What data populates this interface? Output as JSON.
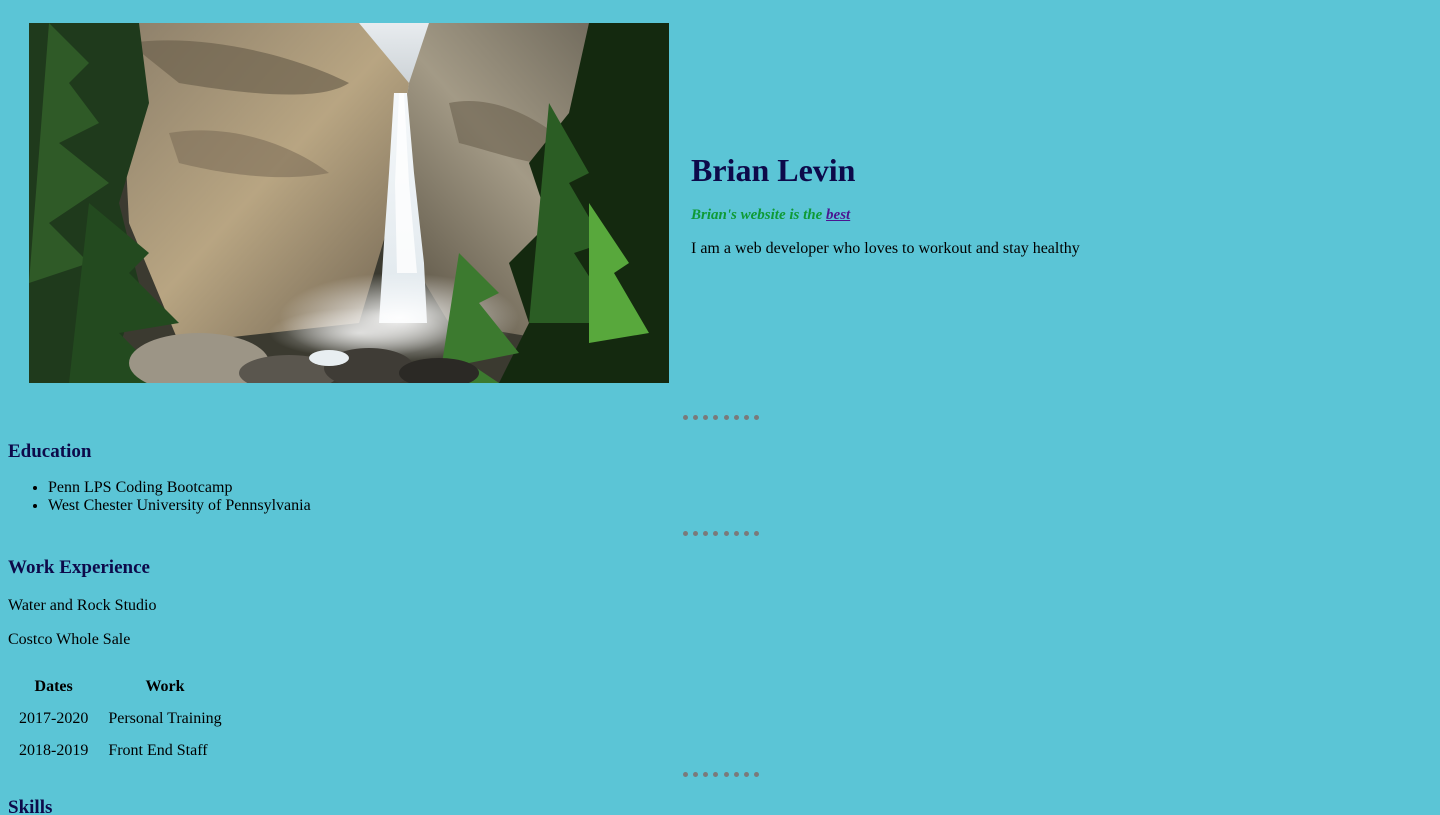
{
  "hero": {
    "name": "Brian Levin",
    "tagline_prefix": "Brian's website is the ",
    "tagline_link": "best",
    "intro": "I am a web developer who loves to workout and stay healthy"
  },
  "education": {
    "title": "Education",
    "items": [
      "Penn LPS Coding Bootcamp",
      "West Chester University of Pennsylvania"
    ]
  },
  "work": {
    "title": "Work Experience",
    "items": [
      "Water and Rock Studio",
      "Costco Whole Sale"
    ],
    "table": {
      "headers": [
        "Dates",
        "Work"
      ],
      "rows": [
        [
          "2017-2020",
          "Personal Training"
        ],
        [
          "2018-2019",
          "Front End Staff"
        ]
      ]
    }
  },
  "skills": {
    "title": "Skills"
  },
  "colors": {
    "background": "#5bc5d6",
    "heading": "#0d0a4a",
    "tagline": "#0e9a35",
    "link": "#4b1590",
    "divider_dots": "#7a7a7a"
  }
}
